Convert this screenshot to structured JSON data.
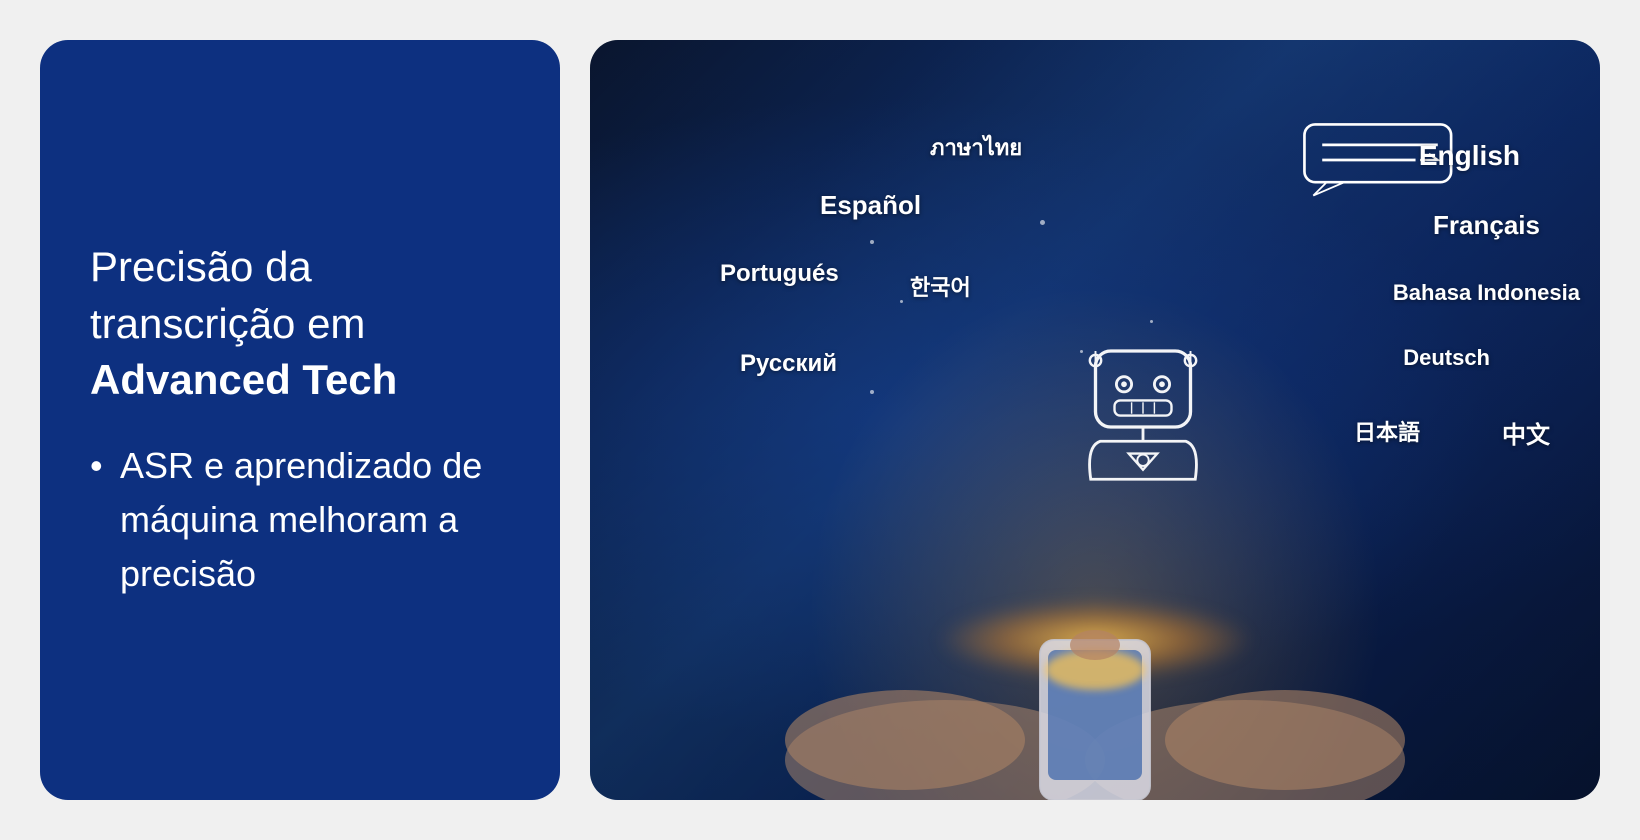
{
  "left": {
    "heading_line1": "Precisão da",
    "heading_line2": "transcrição em",
    "heading_line3": "Advanced Tech",
    "bullet_item": "ASR e aprendizado de máquina melhoram a precisão"
  },
  "right": {
    "languages": [
      {
        "key": "thai",
        "text": "ภาษาไทย",
        "class": "lang-thai"
      },
      {
        "key": "espanol",
        "text": "Español",
        "class": "lang-espanol"
      },
      {
        "key": "portugues",
        "text": "Portugués",
        "class": "lang-portugues"
      },
      {
        "key": "korean",
        "text": "한국어",
        "class": "lang-korean"
      },
      {
        "key": "russian",
        "text": "Русский",
        "class": "lang-russian"
      },
      {
        "key": "english",
        "text": "English",
        "class": "lang-english"
      },
      {
        "key": "francais",
        "text": "Français",
        "class": "lang-francais"
      },
      {
        "key": "bahasa",
        "text": "Bahasa Indonesia",
        "class": "lang-bahasa"
      },
      {
        "key": "deutsch",
        "text": "Deutsch",
        "class": "lang-deutsch"
      },
      {
        "key": "japanese",
        "text": "日本語",
        "class": "lang-japanese"
      },
      {
        "key": "chinese",
        "text": "中文",
        "class": "lang-chinese"
      }
    ]
  },
  "colors": {
    "panel_bg": "#0d3080",
    "text_white": "#ffffff"
  }
}
